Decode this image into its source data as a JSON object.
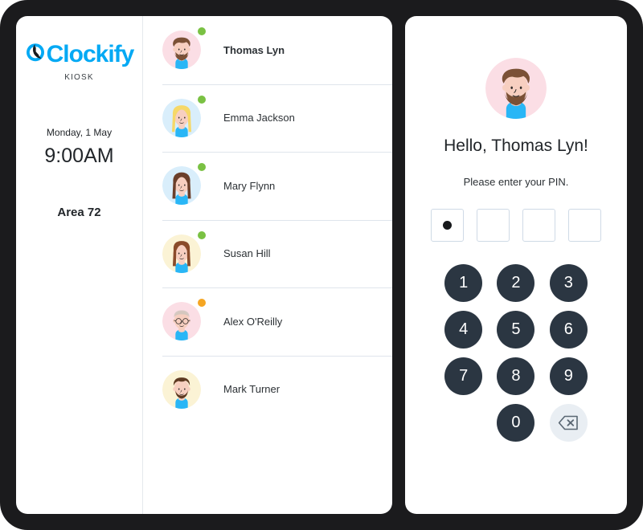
{
  "brand": {
    "name": "Clockify",
    "subtitle": "KIOSK",
    "accent_color": "#03a9f4",
    "logo_icon": "clock-icon"
  },
  "sidebar": {
    "date": "Monday, 1 May",
    "time": "9:00AM",
    "area": "Area 72"
  },
  "user_list": {
    "users": [
      {
        "name": "Thomas Lyn",
        "status": "online",
        "status_color": "#7ac143",
        "selected": true,
        "avatar": {
          "bg": "#fbdee5",
          "skin": "#f7cfc0",
          "hair": "#7b5136",
          "shirt": "#29b6f6",
          "type": "bearded-man"
        }
      },
      {
        "name": "Emma Jackson",
        "status": "online",
        "status_color": "#7ac143",
        "selected": false,
        "avatar": {
          "bg": "#d9eefb",
          "skin": "#f7cfc0",
          "hair": "#f6d868",
          "shirt": "#29b6f6",
          "type": "long-blonde-hair-woman"
        }
      },
      {
        "name": "Mary Flynn",
        "status": "online",
        "status_color": "#7ac143",
        "selected": false,
        "avatar": {
          "bg": "#d9eefb",
          "skin": "#f7cfc0",
          "hair": "#6b3f2a",
          "shirt": "#29b6f6",
          "type": "long-brown-hair-woman"
        }
      },
      {
        "name": "Susan Hill",
        "status": "online",
        "status_color": "#7ac143",
        "selected": false,
        "avatar": {
          "bg": "#fbf3d5",
          "skin": "#f7cfc0",
          "hair": "#8a4b2a",
          "shirt": "#29b6f6",
          "type": "auburn-hair-woman"
        }
      },
      {
        "name": "Alex O'Reilly",
        "status": "away",
        "status_color": "#f5a623",
        "selected": false,
        "avatar": {
          "bg": "#fbdee5",
          "skin": "#f7cfc0",
          "hair": "#cfc6bd",
          "shirt": "#29b6f6",
          "type": "bald-man-with-glasses"
        }
      },
      {
        "name": "Mark Turner",
        "status": "none",
        "status_color": "",
        "selected": false,
        "avatar": {
          "bg": "#fbf3d5",
          "skin": "#f7cfc0",
          "hair": "#5e3a22",
          "shirt": "#29b6f6",
          "type": "short-beard-man"
        }
      }
    ]
  },
  "pin_panel": {
    "greeting": "Hello, Thomas Lyn!",
    "prompt": "Please enter your PIN.",
    "pin_length": 4,
    "pin_filled": 1,
    "keypad": [
      "1",
      "2",
      "3",
      "4",
      "5",
      "6",
      "7",
      "8",
      "9",
      "0"
    ],
    "backspace_icon": "backspace-icon",
    "key_color": "#2b3642",
    "backspace_color": "#e9eef3"
  }
}
